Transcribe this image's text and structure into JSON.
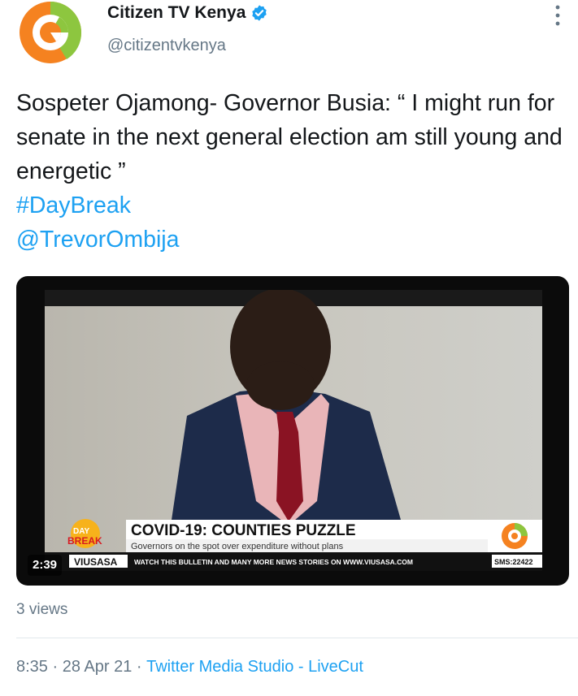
{
  "author": {
    "display_name": "Citizen TV Kenya",
    "handle": "@citizentvkenya",
    "verified": true,
    "verified_color": "#1da1f2"
  },
  "tweet": {
    "text": "Sospeter Ojamong- Governor Busia: “ I might run for senate in the next general election am still young and energetic ”",
    "hashtag": "#DayBreak",
    "mention": "@TrevorOmbija"
  },
  "media": {
    "duration": "2:39",
    "headline": "COVID-19: COUNTIES PUZZLE",
    "subheadline": "Governors on the spot over expenditure without plans",
    "ticker_brand": "VIUSASA",
    "ticker_text": "WATCH THIS BULLETIN AND MANY MORE NEWS STORIES ON WWW.VIUSASA.COM",
    "sms": "SMS:22422",
    "show_logo_top": "DAY",
    "show_logo_bottom": "BREAK"
  },
  "stats": {
    "views": "3 views"
  },
  "footer": {
    "time": "8:35",
    "separator": " · ",
    "date": "28 Apr 21",
    "source": "Twitter Media Studio - LiveCut"
  },
  "colors": {
    "link": "#1da1f2",
    "secondary_text": "#657786",
    "brand_orange": "#f58220",
    "brand_green": "#8dc63f",
    "lower_third_red": "#d71920"
  }
}
